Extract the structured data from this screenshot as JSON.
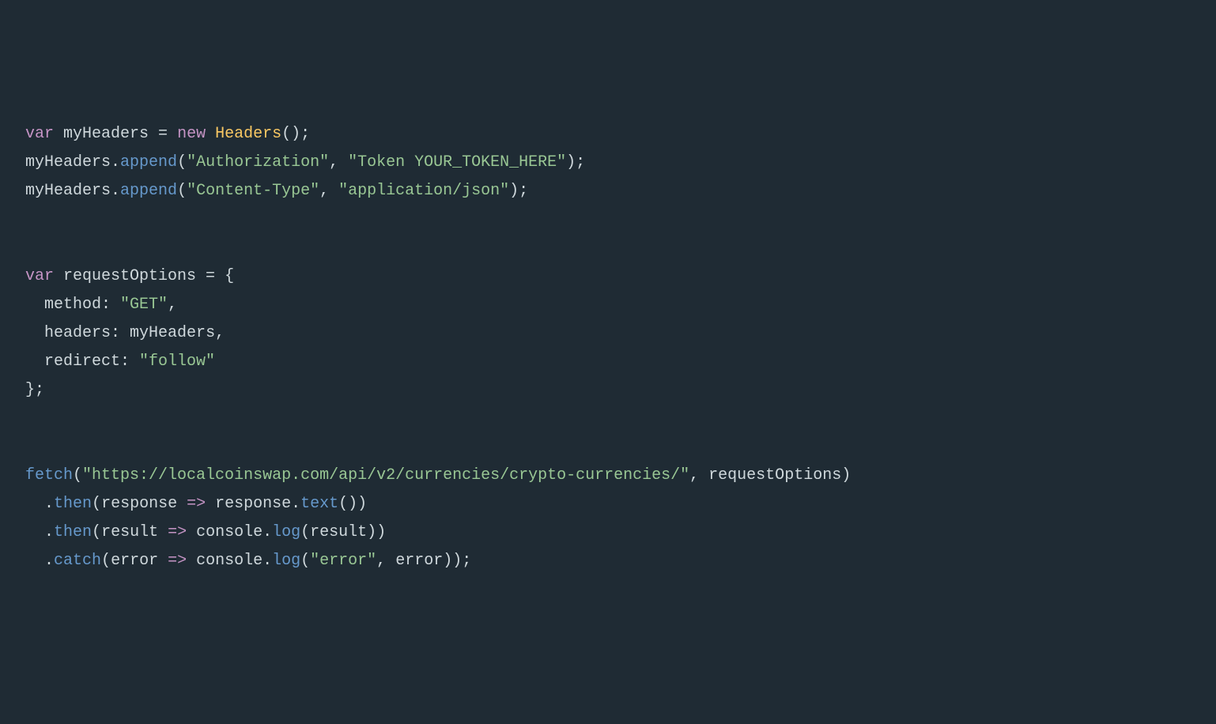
{
  "code": {
    "line1": {
      "kw_var": "var",
      "id_myHeaders": " myHeaders ",
      "eq": "= ",
      "kw_new": "new",
      "sp": " ",
      "fn_Headers": "Headers",
      "parens": "();"
    },
    "line2": {
      "id_myHeaders": "myHeaders",
      "dot": ".",
      "fn_append": "append",
      "open": "(",
      "str1": "\"Authorization\"",
      "comma": ", ",
      "str2": "\"Token YOUR_TOKEN_HERE\"",
      "close": ");"
    },
    "line3": {
      "id_myHeaders": "myHeaders",
      "dot": ".",
      "fn_append": "append",
      "open": "(",
      "str1": "\"Content-Type\"",
      "comma": ", ",
      "str2": "\"application/json\"",
      "close": ");"
    },
    "line5": {
      "kw_var": "var",
      "id_requestOptions": " requestOptions ",
      "eq": "= ",
      "brace": "{"
    },
    "line6": {
      "indent": "  ",
      "key": "method",
      "colon": ": ",
      "str": "\"GET\"",
      "comma": ","
    },
    "line7": {
      "indent": "  ",
      "key": "headers",
      "colon": ": ",
      "val": "myHeaders",
      "comma": ","
    },
    "line8": {
      "indent": "  ",
      "key": "redirect",
      "colon": ": ",
      "str": "\"follow\""
    },
    "line9": {
      "close": "};"
    },
    "line11": {
      "fn_fetch": "fetch",
      "open": "(",
      "str_url": "\"https://localcoinswap.com/api/v2/currencies/crypto-currencies/\"",
      "comma": ", ",
      "id_requestOptions": "requestOptions",
      "close": ")"
    },
    "line12": {
      "indent": "  ",
      "dot": ".",
      "fn_then": "then",
      "open": "(",
      "id_response": "response",
      "arrow": " => ",
      "id_response2": "response",
      "dot2": ".",
      "fn_text": "text",
      "parens": "()",
      "close": ")"
    },
    "line13": {
      "indent": "  ",
      "dot": ".",
      "fn_then": "then",
      "open": "(",
      "id_result": "result",
      "arrow": " => ",
      "id_console": "console",
      "dot2": ".",
      "fn_log": "log",
      "open2": "(",
      "id_result2": "result",
      "close2": ")",
      "close": ")"
    },
    "line14": {
      "indent": "  ",
      "dot": ".",
      "fn_catch": "catch",
      "open": "(",
      "id_error": "error",
      "arrow": " => ",
      "id_console": "console",
      "dot2": ".",
      "fn_log": "log",
      "open2": "(",
      "str_err": "\"error\"",
      "comma": ", ",
      "id_error2": "error",
      "close2": ")",
      "close": ");"
    }
  }
}
